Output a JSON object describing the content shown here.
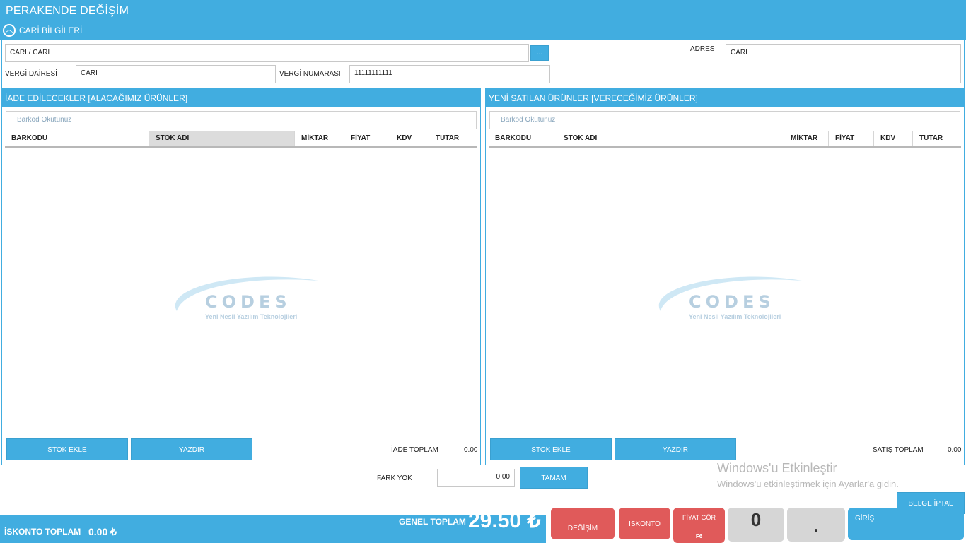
{
  "window": {
    "title": "PERAKENDE DEĞİŞİM"
  },
  "cari_section": {
    "title": "CARİ BİLGİLERİ",
    "cari_value": "CARI / CARI",
    "browse_label": "...",
    "vergi_dairesi_label": "VERGİ DAİRESİ",
    "vergi_dairesi_value": "CARI",
    "vergi_numarasi_label": "VERGİ NUMARASI",
    "vergi_numarasi_value": "11111111111",
    "adres_label": "ADRES",
    "adres_value": "CARI"
  },
  "left_panel": {
    "title": "İADE EDİLECEKLER [ALACAĞIMIZ ÜRÜNLER]",
    "barcode_placeholder": "Barkod Okutunuz",
    "columns": [
      "BARKODU",
      "STOK ADI",
      "MİKTAR",
      "FİYAT",
      "KDV",
      "TUTAR"
    ],
    "stok_ekle": "STOK EKLE",
    "yazdir": "YAZDIR",
    "total_label": "İADE TOPLAM",
    "total_value": "0.00"
  },
  "right_panel": {
    "title": "YENİ SATILAN ÜRÜNLER [VERECEĞİMİZ ÜRÜNLER]",
    "barcode_placeholder": "Barkod Okutunuz",
    "columns": [
      "BARKODU",
      "STOK ADI",
      "MİKTAR",
      "FİYAT",
      "KDV",
      "TUTAR"
    ],
    "stok_ekle": "STOK EKLE",
    "yazdir": "YAZDIR",
    "total_label": "SATIŞ TOPLAM",
    "total_value": "0.00"
  },
  "watermark": {
    "brand": "CODES",
    "tagline": "Yeni Nesil Yazılım Teknolojileri"
  },
  "difference": {
    "label": "FARK YOK",
    "value": "0.00",
    "ok_label": "TAMAM"
  },
  "activation": {
    "title": "Windows'u Etkinleştir",
    "subtitle": "Windows'u etkinleştirmek için Ayarlar'a gidin."
  },
  "belge_iptal": "BELGE İPTAL",
  "footer": {
    "iskonto_label": "İSKONTO TOPLAM",
    "iskonto_value": "0.00 ₺",
    "genel_label": "GENEL TOPLAM",
    "genel_value": "29.50 ₺",
    "degisim": "DEĞİŞİM",
    "iskonto_btn": "İSKONTO",
    "fiyat_gor": "FİYAT GÖR",
    "fiyat_gor_key": "F6",
    "key_zero": "0",
    "key_dot": ".",
    "giris": "GİRİŞ"
  },
  "colors": {
    "accent": "#41ade0",
    "red_button": "#e05a5a",
    "gray_key": "#d6d6d6"
  }
}
